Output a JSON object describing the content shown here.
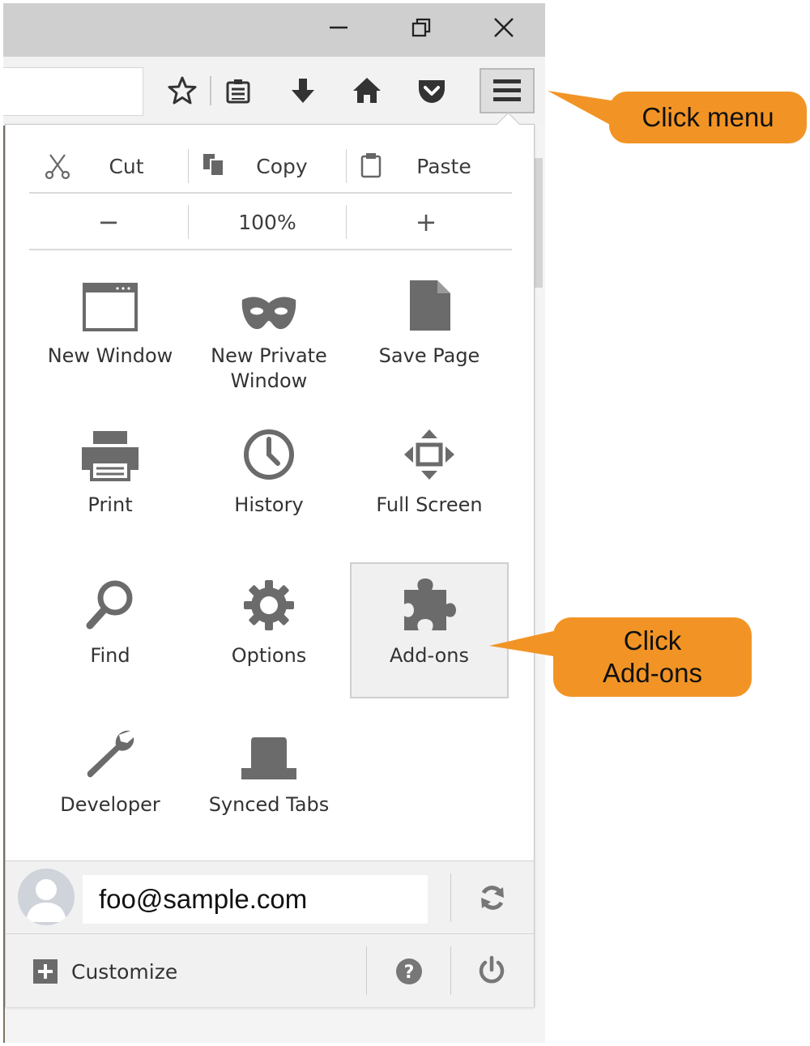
{
  "window": {
    "controls": [
      {
        "name": "minimize",
        "glyph": "—"
      },
      {
        "name": "restore",
        "glyph": "⧉"
      },
      {
        "name": "close",
        "glyph": "✕"
      }
    ]
  },
  "menu": {
    "edit": {
      "cut": "Cut",
      "copy": "Copy",
      "paste": "Paste"
    },
    "zoom": {
      "out": "−",
      "level": "100%",
      "in": "+"
    },
    "items": [
      {
        "label": "New Window",
        "icon": "window-icon"
      },
      {
        "label": "New Private\nWindow",
        "icon": "mask-icon"
      },
      {
        "label": "Save Page",
        "icon": "page-icon"
      },
      {
        "label": "Print",
        "icon": "printer-icon"
      },
      {
        "label": "History",
        "icon": "clock-icon"
      },
      {
        "label": "Full Screen",
        "icon": "fullscreen-icon"
      },
      {
        "label": "Find",
        "icon": "magnifier-icon"
      },
      {
        "label": "Options",
        "icon": "gear-icon"
      },
      {
        "label": "Add-ons",
        "icon": "puzzle-icon",
        "highlighted": true
      },
      {
        "label": "Developer",
        "icon": "wrench-icon"
      },
      {
        "label": "Synced Tabs",
        "icon": "synced-tabs-icon"
      }
    ],
    "account": {
      "email": "foo@sample.com"
    },
    "footer": {
      "customize": "Customize"
    }
  },
  "callouts": {
    "menu": "Click menu",
    "addons": "Click\nAdd-ons"
  },
  "colors": {
    "callout": "#f29425",
    "icon": "#6b6b6b"
  }
}
